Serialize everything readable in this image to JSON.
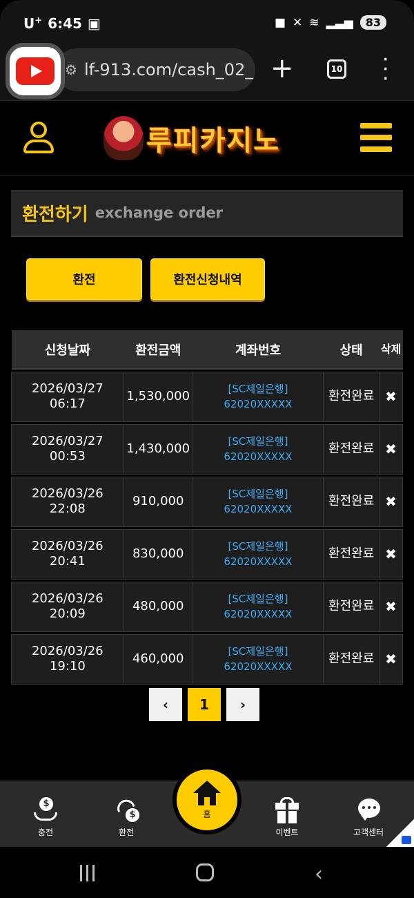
{
  "status_bar": {
    "carrier": "U",
    "carrier_sup": "+",
    "time": "6:45",
    "battery": "83"
  },
  "browser": {
    "url": "lf-913.com/cash_02_",
    "tab_count": "10"
  },
  "header": {
    "logo_text": "루피카지노"
  },
  "page": {
    "title_ko": "환전하기",
    "title_en": "exchange order"
  },
  "tabs": {
    "exchange": "환전",
    "history": "환전신청내역"
  },
  "table": {
    "headers": [
      "신청날짜",
      "환전금액",
      "계좌번호",
      "상태",
      "삭제"
    ],
    "rows": [
      {
        "date": "2026/03/27",
        "time": "06:17",
        "amount": "1,530,000",
        "bank": "[SC제일은행]",
        "account": "62020XXXXX",
        "status": "환전완료"
      },
      {
        "date": "2026/03/27",
        "time": "00:53",
        "amount": "1,430,000",
        "bank": "[SC제일은행]",
        "account": "62020XXXXX",
        "status": "환전완료"
      },
      {
        "date": "2026/03/26",
        "time": "22:08",
        "amount": "910,000",
        "bank": "[SC제일은행]",
        "account": "62020XXXXX",
        "status": "환전완료"
      },
      {
        "date": "2026/03/26",
        "time": "20:41",
        "amount": "830,000",
        "bank": "[SC제일은행]",
        "account": "62020XXXXX",
        "status": "환전완료"
      },
      {
        "date": "2026/03/26",
        "time": "20:09",
        "amount": "480,000",
        "bank": "[SC제일은행]",
        "account": "62020XXXXX",
        "status": "환전완료"
      },
      {
        "date": "2026/03/26",
        "time": "19:10",
        "amount": "460,000",
        "bank": "[SC제일은행]",
        "account": "62020XXXXX",
        "status": "환전완료"
      }
    ],
    "delete_glyph": "✖"
  },
  "pagination": {
    "prev": "‹",
    "current": "1",
    "next": "›"
  },
  "bottom_nav": {
    "deposit": "충전",
    "withdraw": "환전",
    "home": "홈",
    "event": "이벤트",
    "support": "고객센터"
  },
  "colors": {
    "accent": "#ffcc00",
    "link": "#3da9f5",
    "background": "#000000"
  }
}
